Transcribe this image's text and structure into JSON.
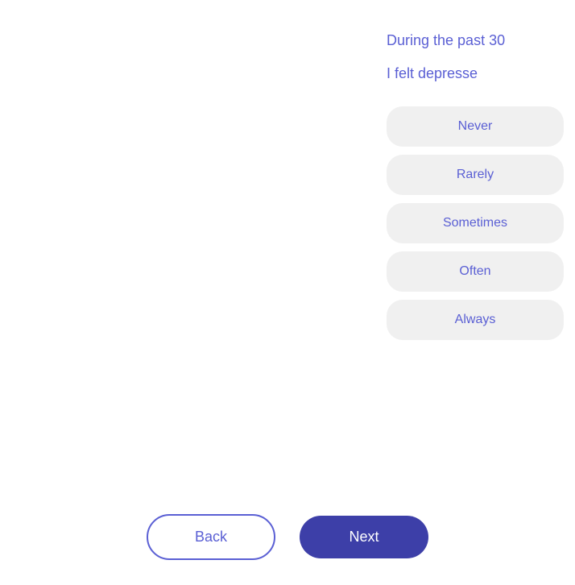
{
  "header": {
    "period_text": "During the past 30",
    "question_text": "I felt depresse"
  },
  "options": [
    {
      "id": "never",
      "label": "Never"
    },
    {
      "id": "rarely",
      "label": "Rarely"
    },
    {
      "id": "sometimes",
      "label": "Sometimes"
    },
    {
      "id": "often",
      "label": "Often"
    },
    {
      "id": "always",
      "label": "Always"
    }
  ],
  "footer": {
    "back_label": "Back",
    "next_label": "Next"
  }
}
